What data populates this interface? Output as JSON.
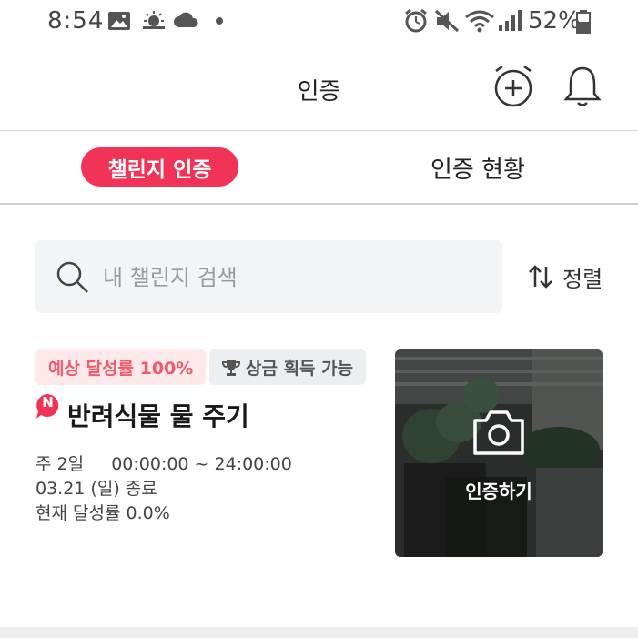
{
  "status_bar": {
    "time": "8:54",
    "battery_percent": "52%",
    "icons": [
      "gallery-icon",
      "weather-sun-icon",
      "cloud-icon",
      "dot-icon",
      "alarm-icon",
      "mute-icon",
      "wifi-icon",
      "signal-icon",
      "battery-icon"
    ]
  },
  "header": {
    "title": "인증",
    "add_challenge_icon": "alarm-plus-icon",
    "notification_icon": "bell-icon"
  },
  "tabs": [
    {
      "label": "챌린지 인증",
      "active": true
    },
    {
      "label": "인증 현황",
      "active": false
    }
  ],
  "search": {
    "placeholder": "내 챌린지 검색",
    "value": ""
  },
  "sort": {
    "label": "정렬"
  },
  "challenge": {
    "rate_badge": "예상 달성률 100%",
    "prize_badge": "상금 획득 가능",
    "new_badge": "N",
    "title": "반려식물 물 주기",
    "schedule_frequency": "주 2일",
    "schedule_time": "00:00:00 ~ 24:00:00",
    "end_date": "03.21 (일) 종료",
    "current_rate": "현재 달성률 0.0%",
    "verify_label": "인증하기"
  },
  "colors": {
    "accent": "#f03356",
    "rate_badge_bg": "#fde8ea",
    "rate_badge_text": "#ef5a6d"
  }
}
